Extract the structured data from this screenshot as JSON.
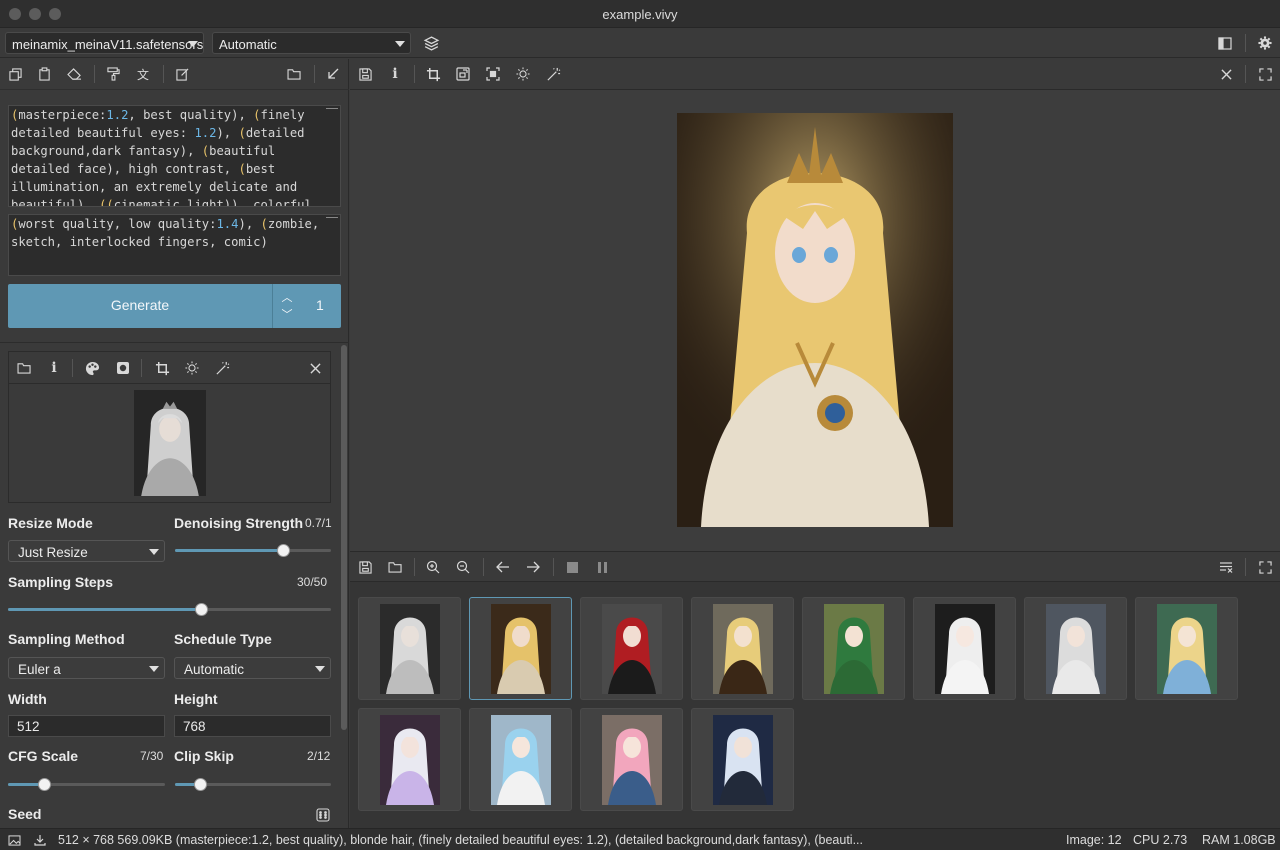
{
  "window": {
    "title": "example.vivy"
  },
  "topbar": {
    "model": "meinamix_meinaV11.safetensors",
    "vae": "Automatic"
  },
  "prompt": {
    "positive_lines": [
      [
        [
          "(",
          "y"
        ],
        [
          "masterpiece:",
          ""
        ],
        [
          "1.2",
          "b"
        ],
        [
          ", best quality), ",
          ""
        ],
        [
          "(",
          "y"
        ],
        [
          "finely",
          ""
        ]
      ],
      [
        [
          "detailed beautiful eyes: ",
          ""
        ],
        [
          "1.2",
          "b"
        ],
        [
          "), ",
          ""
        ],
        [
          "(",
          "y"
        ],
        [
          "detailed",
          ""
        ]
      ],
      [
        [
          "background,dark fantasy), ",
          ""
        ],
        [
          "(",
          "y"
        ],
        [
          "beautiful",
          ""
        ]
      ],
      [
        [
          "detailed face), high contrast, ",
          ""
        ],
        [
          "(",
          "y"
        ],
        [
          "best",
          ""
        ]
      ],
      [
        [
          "illumination, an extremely delicate and",
          ""
        ]
      ],
      [
        [
          "beautiful), ",
          ""
        ],
        [
          "((",
          "y"
        ],
        [
          "cinematic light)), colorful",
          ""
        ]
      ]
    ],
    "negative_lines": [
      [
        [
          "(",
          "y"
        ],
        [
          "worst quality, low quality:",
          ""
        ],
        [
          "1.4",
          "b"
        ],
        [
          "), ",
          ""
        ],
        [
          "(",
          "y"
        ],
        [
          "zombie,",
          ""
        ]
      ],
      [
        [
          "sketch, interlocked fingers, comic)",
          ""
        ]
      ]
    ]
  },
  "generate": {
    "label": "Generate",
    "count": "1",
    "up": "︿",
    "down": "﹀"
  },
  "params": {
    "resize_mode_label": "Resize Mode",
    "resize_mode": "Just Resize",
    "denoising_label": "Denoising Strength",
    "denoising_value": "0.7/1",
    "denoising": 0.7,
    "steps_label": "Sampling Steps",
    "steps_value": "30/50",
    "steps": 0.6,
    "method_label": "Sampling Method",
    "method": "Euler a",
    "schedule_label": "Schedule Type",
    "schedule": "Automatic",
    "width_label": "Width",
    "width": "512",
    "height_label": "Height",
    "height": "768",
    "cfg_label": "CFG Scale",
    "cfg_value": "7/30",
    "cfg": 0.233,
    "clip_label": "Clip Skip",
    "clip_value": "2/12",
    "clip": 0.167,
    "seed_label": "Seed"
  },
  "gallery": {
    "selected_index": 1,
    "thumbs": [
      {
        "bg": "#2b2b2b",
        "hair": "#d9d9d9",
        "cloth": "#bdbdbd",
        "skin": "#e8e0da"
      },
      {
        "bg": "#3b2a1a",
        "hair": "#e5c26a",
        "cloth": "#d9cbb0",
        "skin": "#f0dccb"
      },
      {
        "bg": "#4a4a4a",
        "hair": "#b01d22",
        "cloth": "#1b1b1b",
        "skin": "#f1ddd2"
      },
      {
        "bg": "#6f6a5c",
        "hair": "#e7cc7a",
        "cloth": "#3a2716",
        "skin": "#f3e1cf"
      },
      {
        "bg": "#6b7a46",
        "hair": "#2f7a3e",
        "cloth": "#2c6a35",
        "skin": "#f3e2d3"
      },
      {
        "bg": "#1d1d1d",
        "hair": "#eeeeee",
        "cloth": "#f4f4f4",
        "skin": "#f6e8e0"
      },
      {
        "bg": "#4f5660",
        "hair": "#dcdcdc",
        "cloth": "#e9e9e9",
        "skin": "#f2e3d9"
      },
      {
        "bg": "#3e6a52",
        "hair": "#ecd48a",
        "cloth": "#7fb0d8",
        "skin": "#f4e4d4"
      },
      {
        "bg": "#3a2b3b",
        "hair": "#e9e9f1",
        "cloth": "#c9b4e8",
        "skin": "#f3e3dc"
      },
      {
        "bg": "#9fb7c9",
        "hair": "#9ad2ee",
        "cloth": "#f2f2f2",
        "skin": "#f5e6dc"
      },
      {
        "bg": "#7b6e66",
        "hair": "#f2a6bd",
        "cloth": "#3a5d8a",
        "skin": "#f6e4da"
      },
      {
        "bg": "#1f2a44",
        "hair": "#d9e3f2",
        "cloth": "#222a3a",
        "skin": "#f1e2d8"
      }
    ]
  },
  "main_image": {
    "bg": "#2a1f14",
    "hair": "#e9c771",
    "cloth": "#e7ddcb",
    "skin": "#f2dccb",
    "accent": "#b88a3a"
  },
  "status": {
    "info": "512 × 768 569.09KB (masterpiece:1.2, best quality), blonde hair, (finely detailed beautiful eyes: 1.2), (detailed background,dark fantasy), (beauti...",
    "image_count": "Image: 12",
    "cpu": "CPU 2.73",
    "ram": "RAM 1.08GB"
  }
}
